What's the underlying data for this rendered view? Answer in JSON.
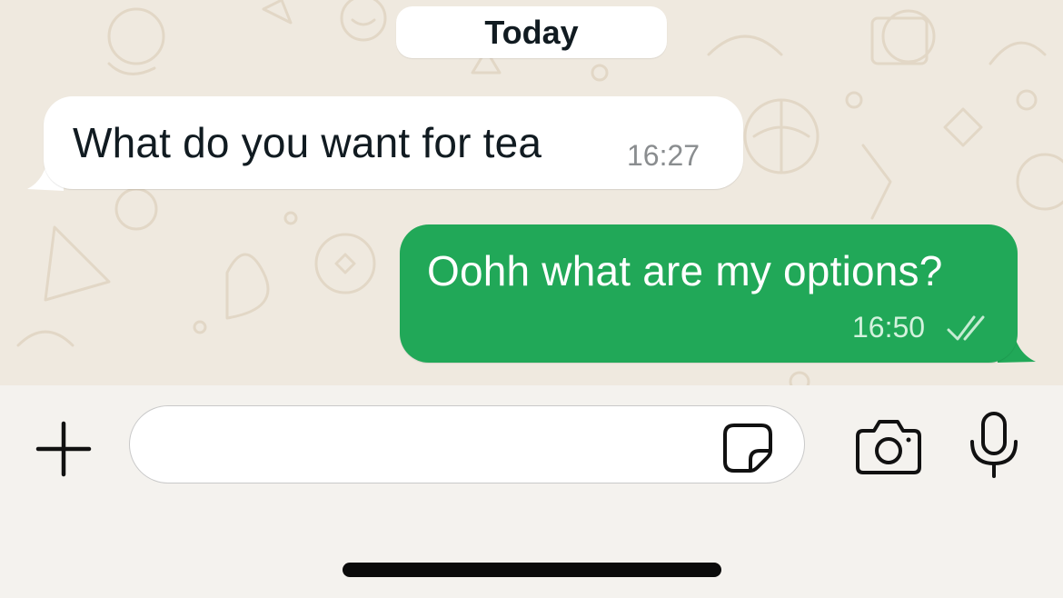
{
  "chat": {
    "date_separator": "Today",
    "messages": [
      {
        "direction": "incoming",
        "text": "What do you want for tea",
        "time": "16:27"
      },
      {
        "direction": "outgoing",
        "text": "Oohh what are my options?",
        "time": "16:50",
        "status_icon": "double-check-icon"
      }
    ]
  },
  "composer": {
    "value": "",
    "placeholder": "",
    "icons": {
      "attach": "plus-icon",
      "sticker": "sticker-icon",
      "camera": "camera-icon",
      "voice": "microphone-icon"
    }
  },
  "colors": {
    "outgoing_bubble": "#21a858",
    "incoming_bubble": "#ffffff",
    "chat_background": "#efe9df",
    "composer_background": "#f4f2ee"
  }
}
